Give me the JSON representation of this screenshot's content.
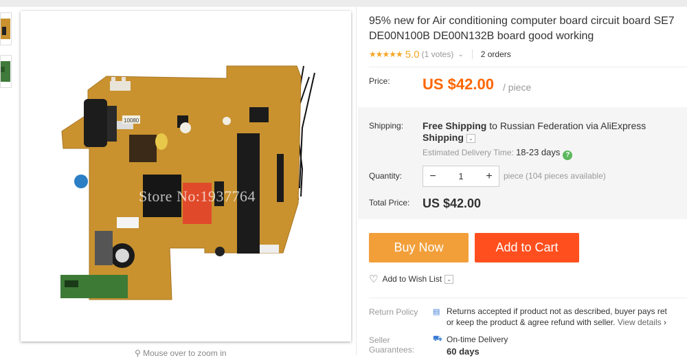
{
  "product": {
    "title_line1": "95% new for Air conditioning computer board circuit board SE7",
    "title_line2": "DE00N100B DE00N132B board good working",
    "stars": "★★★★★",
    "score": "5.0",
    "votes": "(1 votes)",
    "votes_chevron": "⌄",
    "orders": "2 orders"
  },
  "image": {
    "watermark": "Store No:1937764",
    "zoom_hint": "Mouse over to zoom in",
    "magnifier": "⚲",
    "board_label": "10080"
  },
  "price": {
    "label": "Price:",
    "value": "US $42.00",
    "unit": "/ piece"
  },
  "shipping": {
    "label": "Shipping:",
    "free": "Free Shipping",
    "to": " to ",
    "country": "Russian Federation via AliExpress",
    "method": "Shipping",
    "dropdown": "⌄",
    "est_label": "Estimated Delivery Time: ",
    "est_value": "18-23 days",
    "help": "?"
  },
  "quantity": {
    "label": "Quantity:",
    "minus": "−",
    "value": "1",
    "plus": "+",
    "available": "piece (104 pieces available)"
  },
  "total": {
    "label": "Total Price:",
    "value": "US $42.00"
  },
  "actions": {
    "buy_now": "Buy Now",
    "add_to_cart": "Add to Cart",
    "wish_icon": "♡",
    "wish_label": "Add to Wish List",
    "wish_dropdown": "⌄"
  },
  "return_policy": {
    "label": "Return Policy",
    "icon": "▤",
    "line1": "Returns accepted if product not as described, buyer pays ret",
    "line2": "or keep the product & agree refund with seller. ",
    "link": "View details",
    "arrow": "›"
  },
  "seller_guarantees": {
    "label_line1": "Seller",
    "label_line2": "Guarantees:",
    "icon": "⛟",
    "item": "On-time Delivery",
    "days": "60 days"
  },
  "colors": {
    "price": "#ff6600",
    "buy_now": "#f29f3a",
    "add_to_cart": "#ff4f1e",
    "star": "#f5a623",
    "board": "#c9922f"
  }
}
